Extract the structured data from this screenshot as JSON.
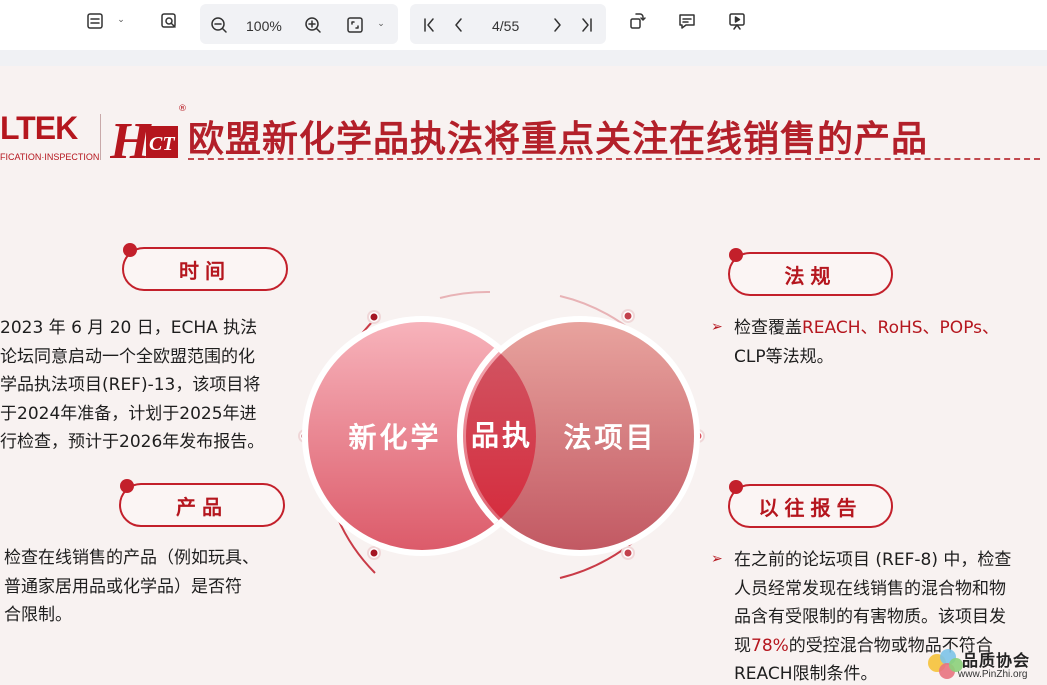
{
  "toolbar": {
    "zoom": "100%",
    "page_indicator": "4/55",
    "icons": [
      "page-view-icon",
      "search-document-icon",
      "zoom-out-icon",
      "zoom-in-icon",
      "fit-page-icon",
      "first-page-icon",
      "previous-page-icon",
      "next-page-icon",
      "last-page-icon",
      "rotate-icon",
      "comment-icon",
      "presentation-icon"
    ]
  },
  "slide": {
    "logo_brand": "LTEK",
    "logo_subtitle": "FICATION·INSPECTION",
    "logo_hc": "HCT",
    "registered": "®",
    "title": "欧盟新化学品执法将重点关注在线销售的产品",
    "sections": {
      "time": {
        "label": "时间",
        "lines": [
          "2023 年 6 月 20 日，ECHA 执法",
          "论坛同意启动一个全欧盟范围的化",
          "学品执法项目(REF)-13，该项目将",
          "于2024年准备，计划于2025年进",
          "行检查，预计于2026年发布报告。"
        ]
      },
      "product": {
        "label": "产品",
        "lines": [
          "检查在线销售的产品（例如玩具、",
          "普通家居用品或化学品）是否符",
          "合限制。"
        ]
      },
      "regulation": {
        "label": "法规",
        "prefix": "检查覆盖",
        "highlight": "REACH、RoHS、POPs、",
        "line2": "CLP等法规。"
      },
      "previous_report": {
        "label": "以往报告",
        "line1": "在之前的论坛项目 (REF-8) 中，检查",
        "line2": "人员经常发现在线销售的混合物和物",
        "line3": "品含有受限制的有害物质。该项目发",
        "line4_pre": "现",
        "line4_highlight": "78%",
        "line4_post": "的受控混合物或物品不符合",
        "line5": "REACH限制条件。"
      }
    },
    "venn": {
      "left": "新化学",
      "middle": "品执",
      "right": "法项目"
    },
    "watermark": {
      "text": "品质协会",
      "url": "www.PinZhi.org"
    }
  },
  "colors": {
    "brand_red": "#b5161e",
    "slide_bg": "#f8f2f1"
  }
}
